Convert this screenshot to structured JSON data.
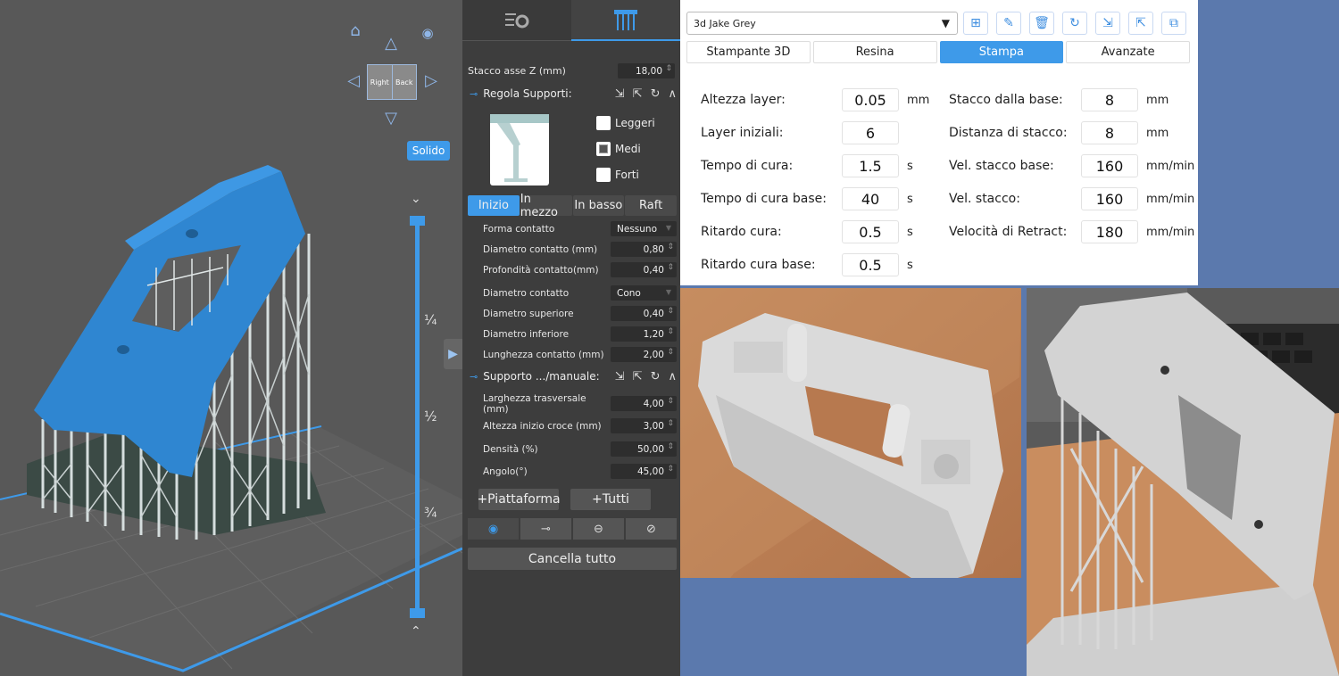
{
  "viewport": {
    "solid_label": "Solido",
    "cube_faces": [
      "Right",
      "Back"
    ],
    "fractions": [
      "¼",
      "½",
      "¾"
    ]
  },
  "panel": {
    "z_lift": {
      "label": "Stacco asse Z (mm)",
      "value": "18,00"
    },
    "adjust_supports": {
      "label": "Regola Supporti:"
    },
    "densities": [
      {
        "label": "Leggeri",
        "checked": false
      },
      {
        "label": "Medi",
        "checked": true
      },
      {
        "label": "Forti",
        "checked": false
      }
    ],
    "tabs": [
      {
        "label": "Inizio",
        "active": true
      },
      {
        "label": "In mezzo",
        "active": false
      },
      {
        "label": "In basso",
        "active": false
      },
      {
        "label": "Raft",
        "active": false
      }
    ],
    "contact_shape": {
      "label": "Forma contatto",
      "value": "Nessuno"
    },
    "contact_diameter_mm": {
      "label": "Diametro contatto (mm)",
      "value": "0,80"
    },
    "contact_depth_mm": {
      "label": "Profondità contatto(mm)",
      "value": "0,40"
    },
    "contact_diameter": {
      "label": "Diametro contatto",
      "value": "Cono"
    },
    "top_diameter": {
      "label": "Diametro superiore",
      "value": "0,40"
    },
    "bottom_diameter": {
      "label": "Diametro inferiore",
      "value": "1,20"
    },
    "contact_length": {
      "label": "Lunghezza contatto (mm)",
      "value": "2,00"
    },
    "manual_support": {
      "label": "Supporto .../manuale:"
    },
    "cross_width": {
      "label": "Larghezza trasversale (mm)",
      "value": "4,00"
    },
    "cross_start_height": {
      "label": "Altezza inizio croce (mm)",
      "value": "3,00"
    },
    "density": {
      "label": "Densità (%)",
      "value": "50,00"
    },
    "angle": {
      "label": "Angolo(°)",
      "value": "45,00"
    },
    "add_platform": "+Piattaforma",
    "add_all": "+Tutti",
    "clear_all": "Cancella tutto"
  },
  "profile": {
    "name": "3d Jake Grey",
    "tabs": [
      {
        "label": "Stampante 3D",
        "active": false
      },
      {
        "label": "Resina",
        "active": false
      },
      {
        "label": "Stampa",
        "active": true
      },
      {
        "label": "Avanzate",
        "active": false
      }
    ],
    "left_params": [
      {
        "label": "Altezza layer:",
        "value": "0.05",
        "unit": "mm"
      },
      {
        "label": "Layer iniziali:",
        "value": "6",
        "unit": ""
      },
      {
        "label": "Tempo di cura:",
        "value": "1.5",
        "unit": "s"
      },
      {
        "label": "Tempo di cura base:",
        "value": "40",
        "unit": "s"
      },
      {
        "label": "Ritardo cura:",
        "value": "0.5",
        "unit": "s"
      },
      {
        "label": "Ritardo cura base:",
        "value": "0.5",
        "unit": "s"
      }
    ],
    "right_params": [
      {
        "label": "Stacco dalla base:",
        "value": "8",
        "unit": "mm"
      },
      {
        "label": "Distanza di stacco:",
        "value": "8",
        "unit": "mm"
      },
      {
        "label": "Vel. stacco base:",
        "value": "160",
        "unit": "mm/min"
      },
      {
        "label": "Vel. stacco:",
        "value": "160",
        "unit": "mm/min"
      },
      {
        "label": "Velocità di Retract:",
        "value": "180",
        "unit": "mm/min"
      }
    ]
  },
  "colors": {
    "accent": "#3e9ae9",
    "model": "#2f86d1",
    "panel_bg": "#3d3d3d",
    "viewport_bg": "#585858"
  }
}
